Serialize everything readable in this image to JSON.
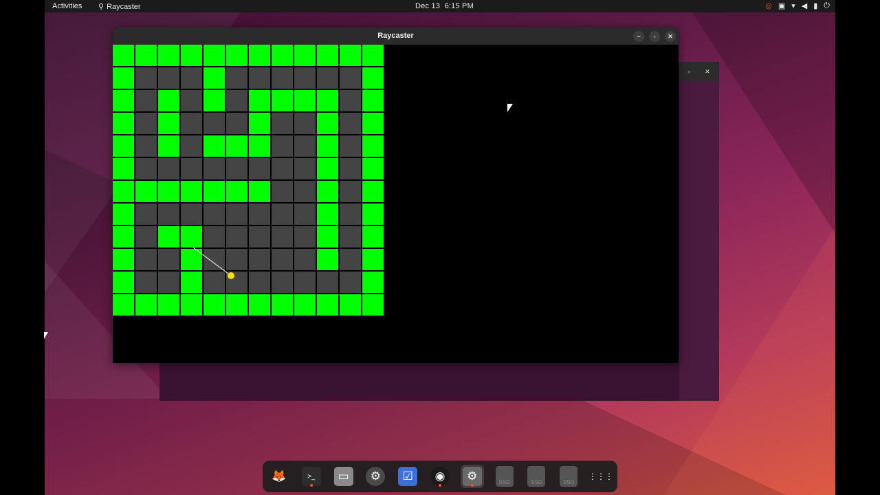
{
  "topbar": {
    "activities": "Activities",
    "app_name": "Raycaster",
    "date": "Dec 13",
    "time": "6:15 PM"
  },
  "window": {
    "title": "Raycaster",
    "minimize_icon": "minimize-icon",
    "maximize_icon": "maximize-icon",
    "close_icon": "close-icon"
  },
  "map": {
    "rows": 12,
    "cols": 12,
    "wall_color": "#00ff00",
    "floor_color": "#444444",
    "grid": [
      [
        1,
        1,
        1,
        1,
        1,
        1,
        1,
        1,
        1,
        1,
        1,
        1
      ],
      [
        1,
        0,
        0,
        0,
        1,
        0,
        0,
        0,
        0,
        0,
        0,
        1
      ],
      [
        1,
        0,
        1,
        0,
        1,
        0,
        1,
        1,
        1,
        1,
        0,
        1
      ],
      [
        1,
        0,
        1,
        0,
        0,
        0,
        1,
        0,
        0,
        1,
        0,
        1
      ],
      [
        1,
        0,
        1,
        0,
        1,
        1,
        1,
        0,
        0,
        1,
        0,
        1
      ],
      [
        1,
        0,
        0,
        0,
        0,
        0,
        0,
        0,
        0,
        1,
        0,
        1
      ],
      [
        1,
        1,
        1,
        1,
        1,
        1,
        1,
        0,
        0,
        1,
        0,
        1
      ],
      [
        1,
        0,
        0,
        0,
        0,
        0,
        0,
        0,
        0,
        1,
        0,
        1
      ],
      [
        1,
        0,
        1,
        1,
        0,
        0,
        0,
        0,
        0,
        1,
        0,
        1
      ],
      [
        1,
        0,
        0,
        1,
        0,
        0,
        0,
        0,
        0,
        1,
        0,
        1
      ],
      [
        1,
        0,
        0,
        1,
        0,
        0,
        0,
        0,
        0,
        0,
        0,
        1
      ],
      [
        1,
        1,
        1,
        1,
        1,
        1,
        1,
        1,
        1,
        1,
        1,
        1
      ]
    ],
    "player_color": "#ffe000"
  },
  "dock": {
    "items": [
      {
        "name": "firefox-icon"
      },
      {
        "name": "terminal-icon"
      },
      {
        "name": "files-icon"
      },
      {
        "name": "settings-gear-icon"
      },
      {
        "name": "tasks-icon"
      },
      {
        "name": "obs-icon"
      },
      {
        "name": "settings-app-icon"
      },
      {
        "name": "ssd-drive-icon",
        "label": "SSD"
      },
      {
        "name": "ssd-drive-icon",
        "label": "SSD"
      },
      {
        "name": "ssd-drive-icon",
        "label": "SSD"
      },
      {
        "name": "app-grid-icon"
      }
    ]
  }
}
